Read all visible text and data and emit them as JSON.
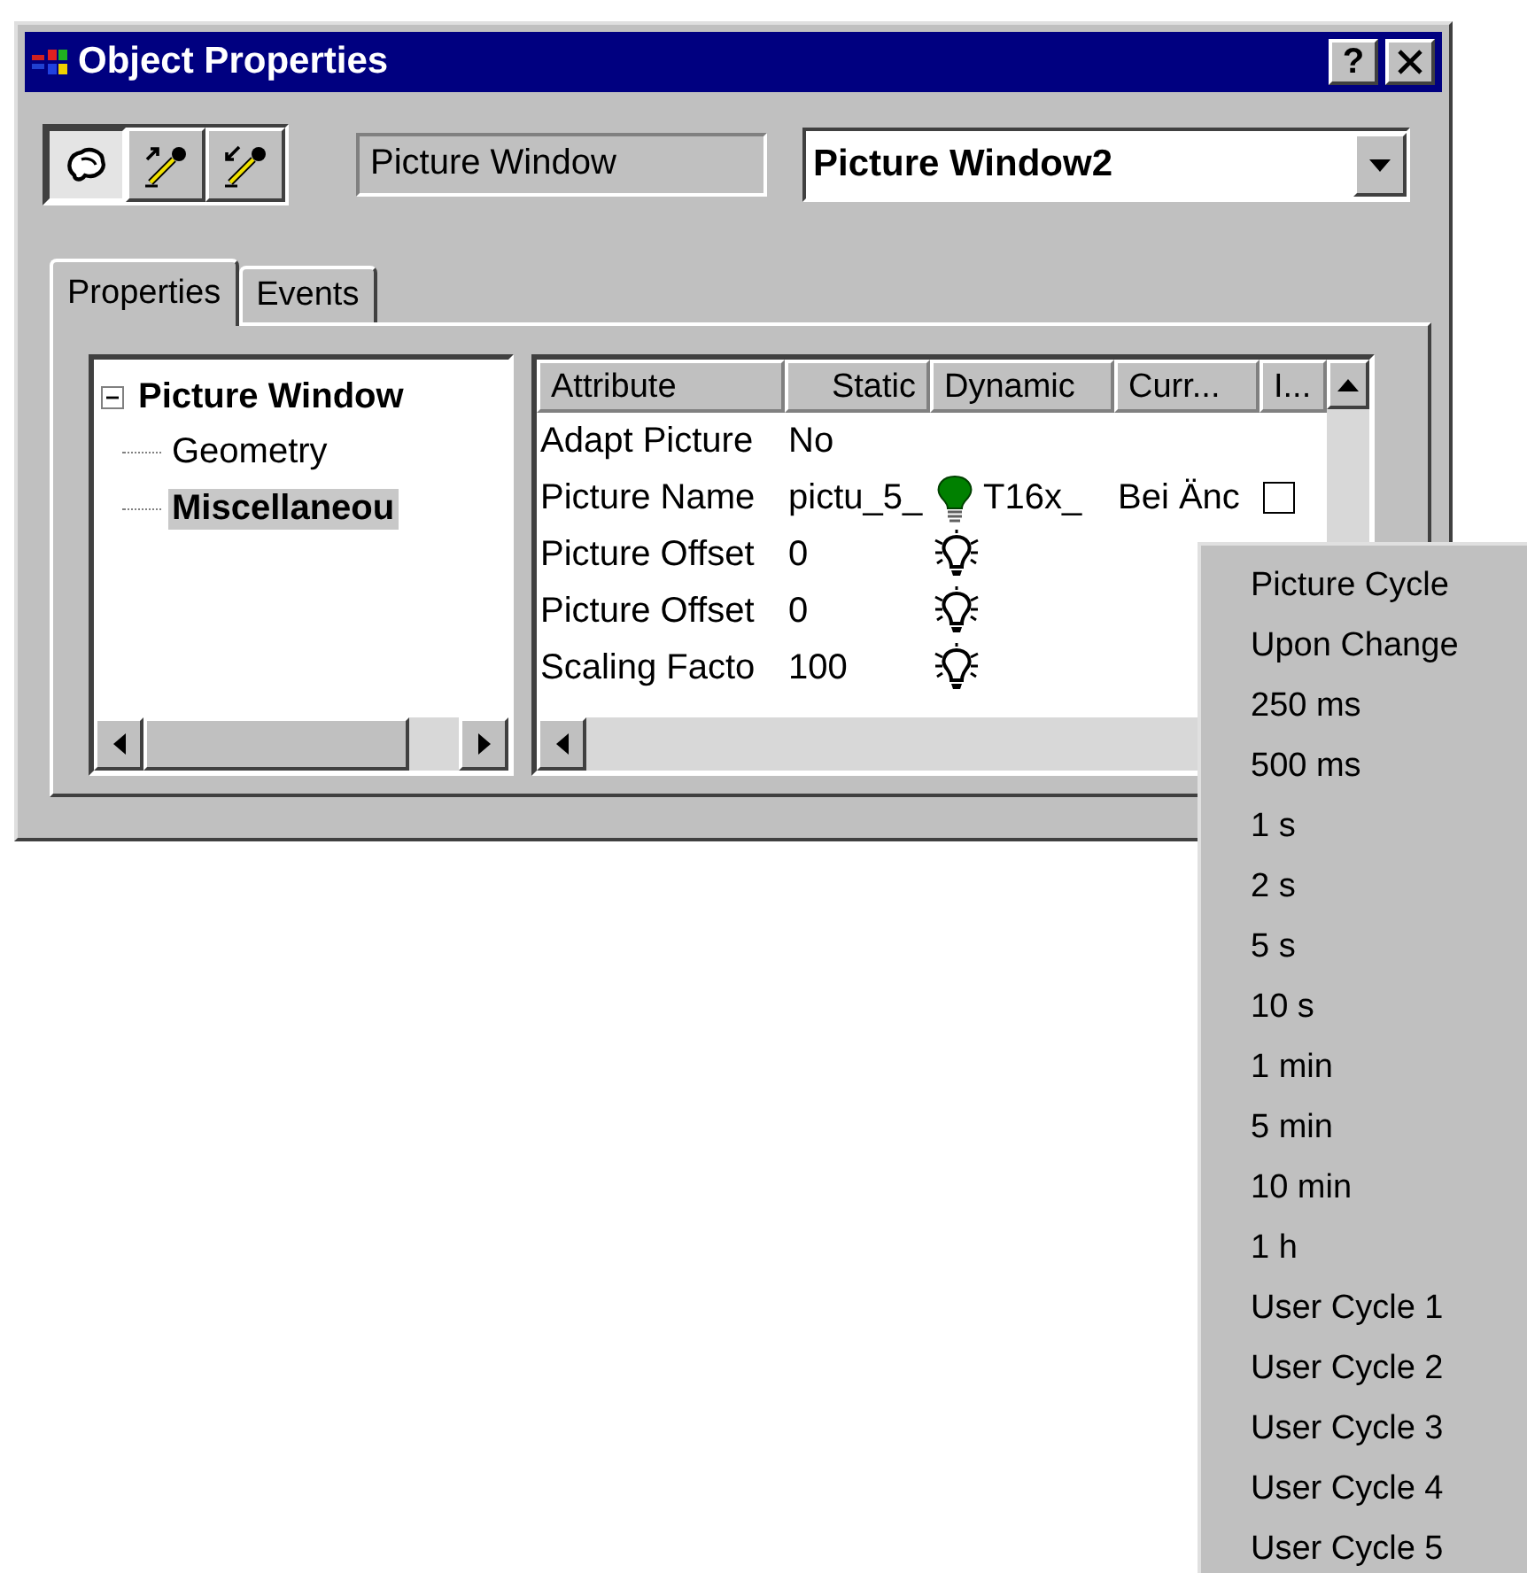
{
  "window": {
    "title": "Object Properties",
    "help": "?"
  },
  "toolbar": [
    {
      "kind": "shape",
      "pressed": true
    },
    {
      "kind": "pick-out",
      "pressed": false
    },
    {
      "kind": "pick-in",
      "pressed": false
    }
  ],
  "object_type": "Picture Window",
  "object_name": "Picture Window2",
  "tabs": [
    {
      "label": "Properties",
      "selected": true
    },
    {
      "label": "Events",
      "selected": false
    }
  ],
  "tree": [
    {
      "label": "Picture Window",
      "expanded": true,
      "selected": false,
      "children": [
        {
          "label": "Geometry",
          "selected": false
        },
        {
          "label": "Miscellaneou",
          "selected": true
        }
      ]
    }
  ],
  "table": {
    "columns": [
      "Attribute",
      "Static",
      "Dynamic",
      "Curr...",
      "I..."
    ],
    "rows": [
      {
        "attribute": "Adapt Picture",
        "static": "No"
      },
      {
        "attribute": "Picture Name",
        "static": "pictu_5_",
        "dynamic": {
          "active": true,
          "text": "T16x_"
        },
        "current": "Bei Änc",
        "indirect": {
          "checked": false
        }
      },
      {
        "attribute": "Picture Offset",
        "static": "0",
        "dynamic": {
          "active": false
        }
      },
      {
        "attribute": "Picture Offset",
        "static": "0",
        "dynamic": {
          "active": false
        }
      },
      {
        "attribute": "Scaling Facto",
        "static": "100",
        "dynamic": {
          "active": false
        }
      }
    ]
  },
  "menu": {
    "items": [
      "Picture Cycle",
      "Upon Change",
      "250 ms",
      "500 ms",
      "1 s",
      "2 s",
      "5 s",
      "10 s",
      "1 min",
      "5 min",
      "10 min",
      "1 h",
      "User Cycle 1",
      "User Cycle 2",
      "User Cycle 3",
      "User Cycle 4",
      "User Cycle 5"
    ]
  }
}
